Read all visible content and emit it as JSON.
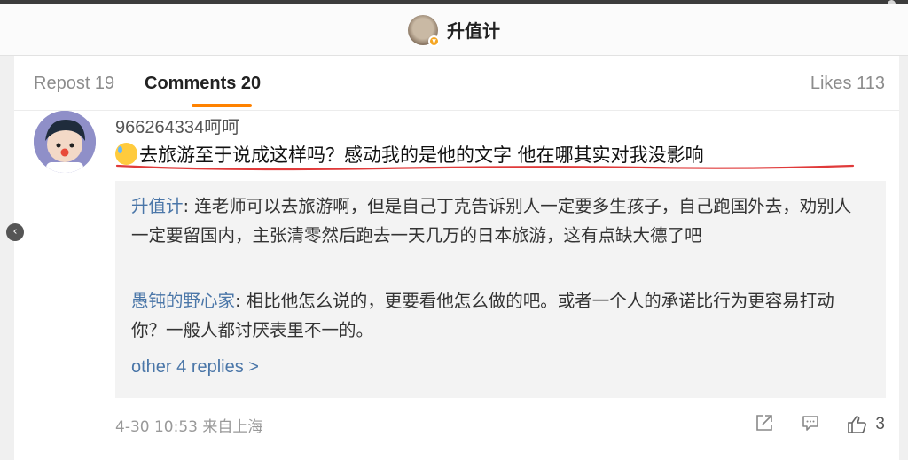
{
  "header": {
    "title": "升值计"
  },
  "tabs": {
    "repost": "Repost 19",
    "comments": "Comments 20",
    "likes": "Likes 113"
  },
  "comment": {
    "username": "966264334呵呵",
    "text": "去旅游至于说成这样吗？感动我的是他的文字 他在哪其实对我没影响",
    "replies": [
      {
        "name": "升值计",
        "text": ": 连老师可以去旅游啊，但是自己丁克告诉别人一定要多生孩子，自己跑国外去，劝别人一定要留国内，主张清零然后跑去一天几万的日本旅游，这有点缺大德了吧"
      },
      {
        "name": "愚钝的野心家",
        "text": ": 相比他怎么说的，更要看他怎么做的吧。或者一个人的承诺比行为更容易打动你？一般人都讨厌表里不一的。"
      }
    ],
    "more_replies": "other 4 replies >",
    "timestamp": "4-30 10:53 来自上海",
    "like_count": "3"
  },
  "colors": {
    "accent": "#ff8200",
    "link": "#4a76a8",
    "annotation": "#e03a3a"
  },
  "icons": {
    "repost": "share-out-icon",
    "comment": "comment-icon",
    "like": "thumbs-up-icon",
    "badge": "verified-badge-icon",
    "emoji": "sweat-emoji-icon"
  }
}
